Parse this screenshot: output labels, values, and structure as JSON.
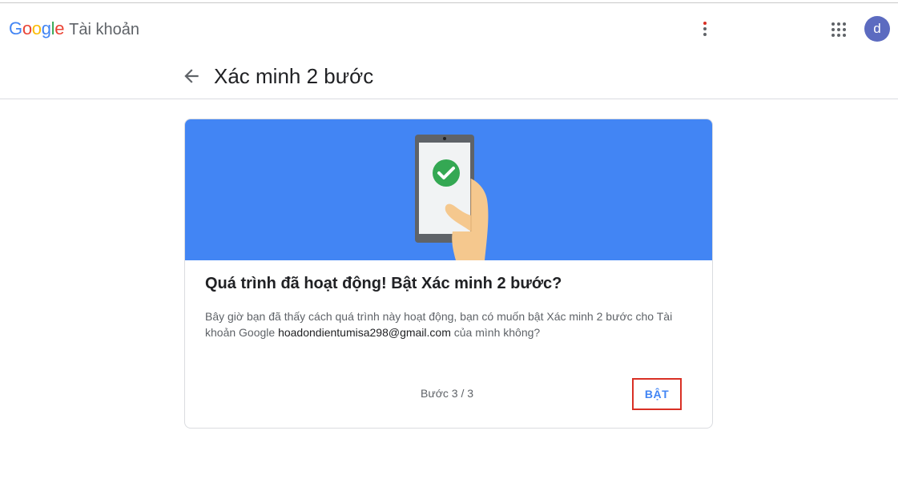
{
  "app": {
    "logo": "Google",
    "product": "Tài khoản"
  },
  "header": {
    "avatar_letter": "d"
  },
  "page": {
    "title": "Xác minh 2 bước"
  },
  "card": {
    "title": "Quá trình đã hoạt động! Bật Xác minh 2 bước?",
    "body_before": "Bây giờ bạn đã thấy cách quá trình này hoạt động, bạn có muốn bật Xác minh 2 bước cho Tài khoản Google ",
    "email": "hoadondientumisa298@gmail.com",
    "body_after": " của mình không?",
    "step": "Bước 3 / 3",
    "turn_on_label": "BẬT"
  },
  "colors": {
    "hero_blue": "#4285f4",
    "check_green": "#34a853",
    "highlight_red": "#d93025",
    "avatar": "#5c6bc0"
  },
  "icons": [
    "more-vert-icon",
    "apps-grid-icon",
    "back-arrow-icon",
    "phone-check-illustration"
  ]
}
